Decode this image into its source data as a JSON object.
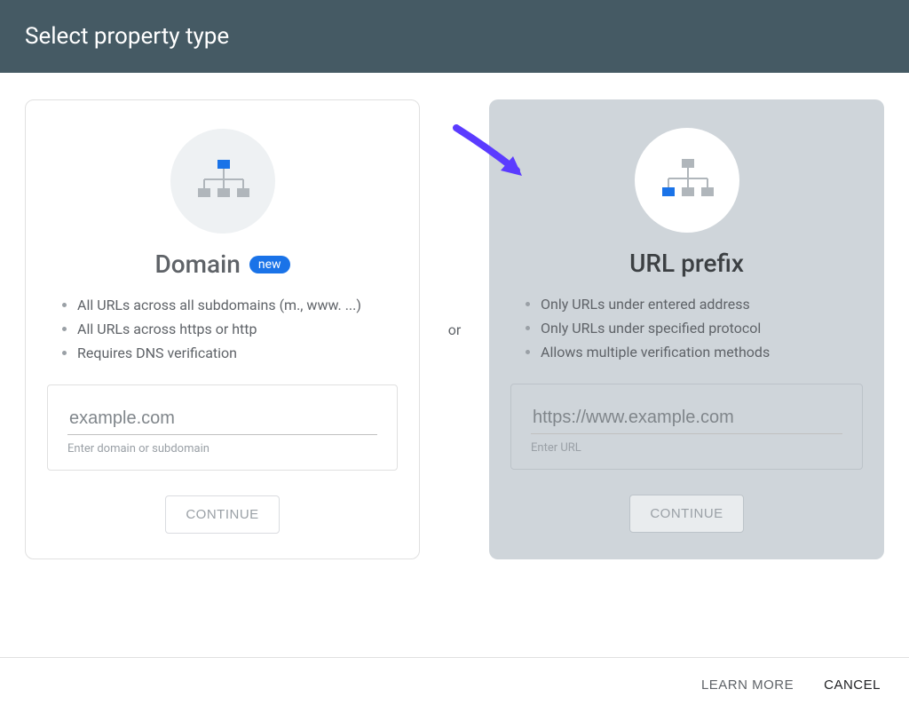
{
  "header": {
    "title": "Select property type"
  },
  "separator": "or",
  "domain_card": {
    "title": "Domain",
    "badge": "new",
    "bullets": [
      "All URLs across all subdomains (m., www. ...)",
      "All URLs across https or http",
      "Requires DNS verification"
    ],
    "placeholder": "example.com",
    "hint": "Enter domain or subdomain",
    "continue": "CONTINUE"
  },
  "url_card": {
    "title": "URL prefix",
    "bullets": [
      "Only URLs under entered address",
      "Only URLs under specified protocol",
      "Allows multiple verification methods"
    ],
    "placeholder": "https://www.example.com",
    "hint": "Enter URL",
    "continue": "CONTINUE"
  },
  "footer": {
    "learn": "LEARN MORE",
    "cancel": "CANCEL"
  }
}
